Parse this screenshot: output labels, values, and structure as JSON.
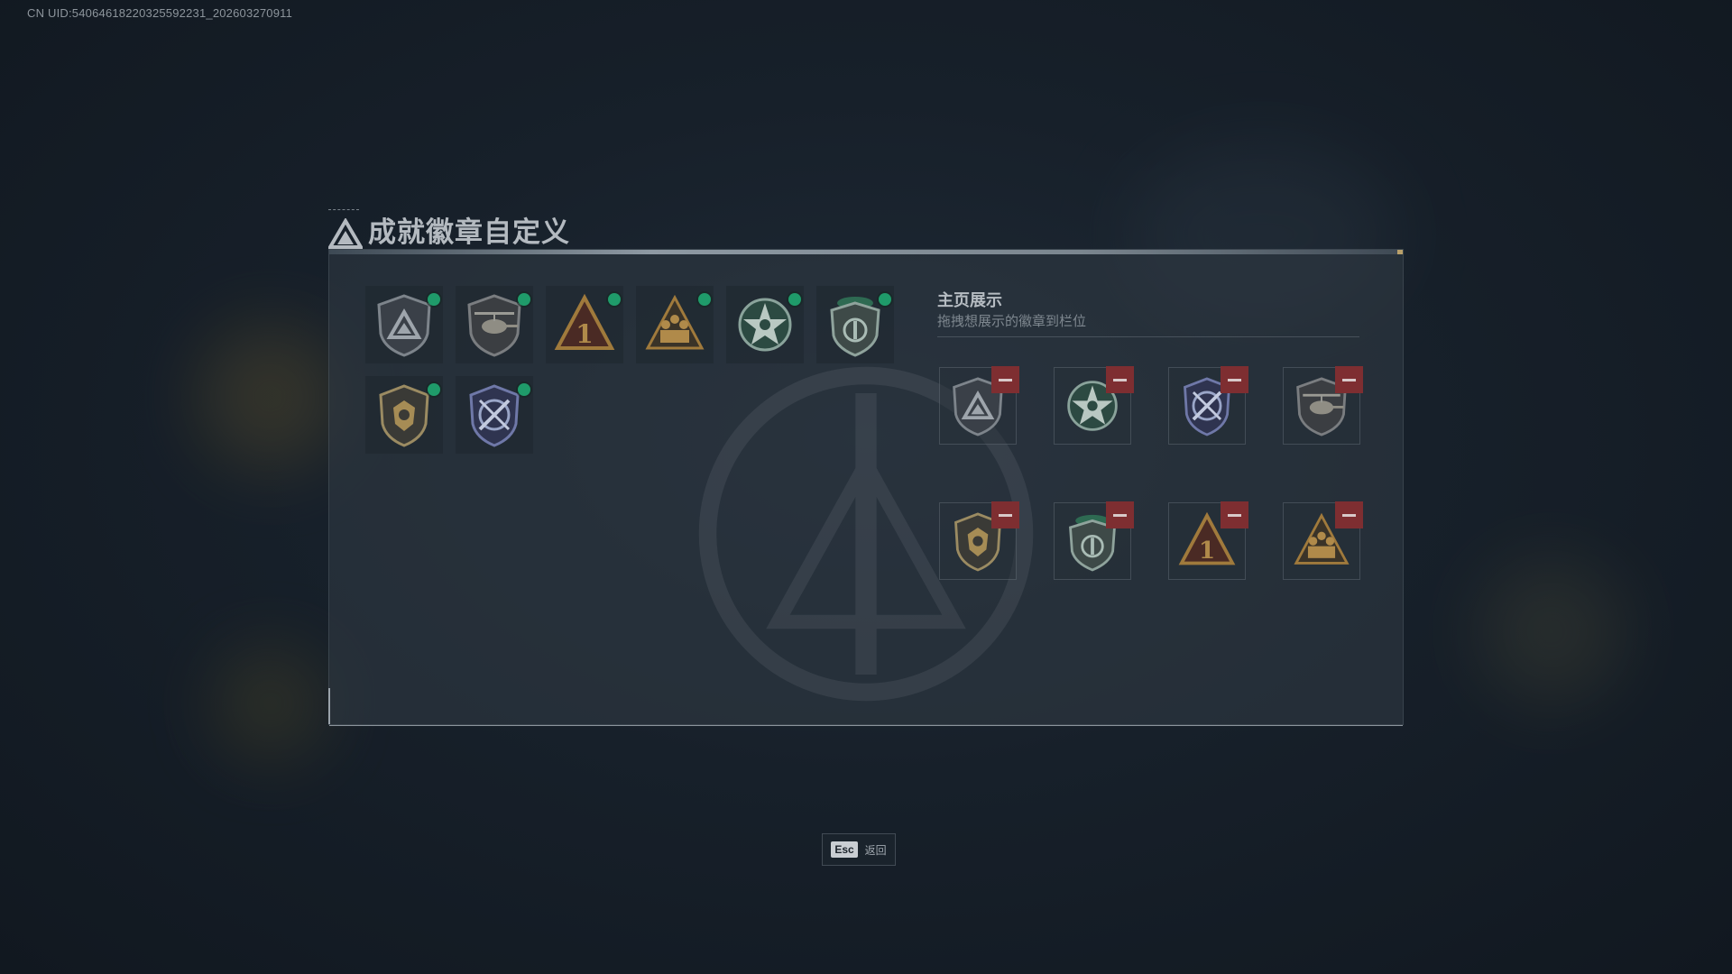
{
  "uid_text": "CN UID:5406461822032559223​1_202603270911",
  "title": "成就徽章自定义",
  "display": {
    "title": "主页展示",
    "subtitle": "拖拽想展示的徽章到栏位"
  },
  "footer": {
    "esc_key": "Esc",
    "esc_label": "返回"
  },
  "owned_badges": [
    {
      "name": "triangle-shield-badge-icon",
      "equipped": true
    },
    {
      "name": "helicopter-shield-badge-icon",
      "equipped": true
    },
    {
      "name": "number-one-triangle-badge-icon",
      "equipped": true
    },
    {
      "name": "squad-triangle-badge-icon",
      "equipped": true
    },
    {
      "name": "green-star-badge-icon",
      "equipped": true
    },
    {
      "name": "green-beret-shield-badge-icon",
      "equipped": true
    },
    {
      "name": "lion-shield-badge-icon",
      "equipped": true
    },
    {
      "name": "crossed-arrows-shield-badge-icon",
      "equipped": true
    }
  ],
  "display_slots": [
    {
      "name": "triangle-shield-badge-icon"
    },
    {
      "name": "green-star-badge-icon"
    },
    {
      "name": "crossed-arrows-shield-badge-icon"
    },
    {
      "name": "helicopter-shield-badge-icon"
    },
    {
      "name": "lion-shield-badge-icon"
    },
    {
      "name": "green-beret-shield-badge-icon"
    },
    {
      "name": "number-one-triangle-badge-icon"
    },
    {
      "name": "squad-triangle-badge-icon"
    }
  ],
  "colors": {
    "accent_green": "#1f9b6a",
    "remove_red": "#7e2e31",
    "gold": "#b08a4a"
  }
}
